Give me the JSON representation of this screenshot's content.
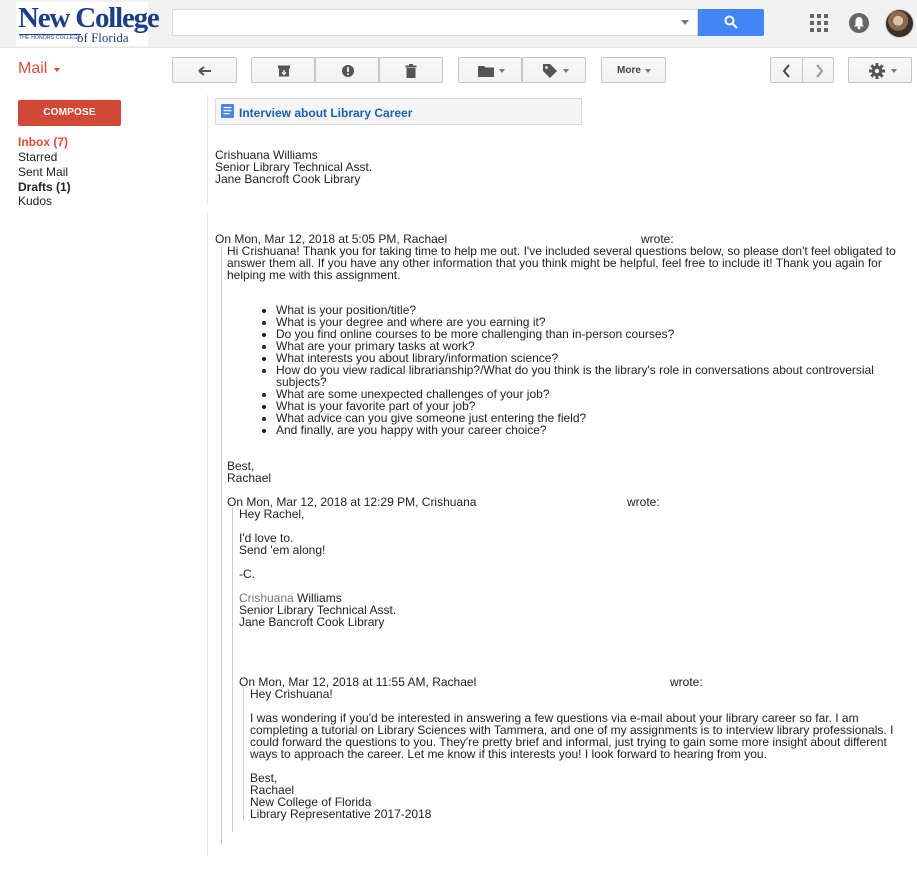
{
  "header": {
    "logo": {
      "name": "New College",
      "tagline": "THE HONORS COLLEGE",
      "sub": "of Florida"
    },
    "search": {
      "value": "",
      "placeholder": ""
    }
  },
  "toolbar": {
    "app_label": "Mail",
    "more_label": "More"
  },
  "sidebar": {
    "compose_label": "COMPOSE",
    "items": [
      {
        "label": "Inbox (7)"
      },
      {
        "label": "Starred"
      },
      {
        "label": "Sent Mail"
      },
      {
        "label": "Drafts (1)"
      },
      {
        "label": "Kudos"
      }
    ]
  },
  "thread": {
    "subject": "Interview about Library Career",
    "reply": {
      "name": "Crishuana Williams",
      "title": "Senior Library Technical Asst.",
      "org": "Jane Bancroft Cook Library"
    },
    "quote1": {
      "header_a": "On Mon, Mar 12, 2018 at 5:05 PM, Rachael",
      "header_b": "wrote:",
      "intro": "Hi Crishuana! Thank you for taking time to help me out. I've included several questions below, so please don't feel obligated to answer them all. If you have any other information that you think might be helpful, feel free to include it! Thank you again for helping me with this assignment.",
      "questions": [
        "What is your position/title?",
        "What is your degree and where are you earning it?",
        "Do you find online courses to be more challenging than in-person courses?",
        "What are your primary tasks at work?",
        "What interests you about library/information science?",
        "How do you view radical librarianship?/What do you think is the library's role in conversations about controversial subjects?",
        "What are some unexpected challenges of your job?",
        "What is your favorite part of your job?",
        "What advice can you give someone just entering the field?",
        "And finally, are you happy with your career choice?"
      ],
      "closing": "Best,",
      "signature": "Rachael"
    },
    "quote2": {
      "header_a": "On Mon, Mar 12, 2018 at 12:29 PM, Crishuana",
      "header_b": "wrote:",
      "greeting": "Hey Rachel,",
      "line1": "I'd love to.",
      "line2": "Send 'em along!",
      "initial": "-C.",
      "sig_first": "Crishuana",
      "sig_last": "Williams",
      "sig_title": "Senior Library Technical Asst.",
      "sig_org": "Jane Bancroft Cook Library"
    },
    "quote3": {
      "header_a": "On Mon, Mar 12, 2018 at 11:55 AM, Rachael",
      "header_b": "wrote:",
      "greeting": "Hey Crishuana!",
      "body": "I was wondering if you'd be interested in answering a few questions via e-mail about your library career so far. I am completing a tutorial on Library Sciences with Tammera, and one of my assignments is to interview library professionals. I could forward the questions to you. They're pretty brief and informal, just trying to gain some more insight about different ways to approach the career. Let me know if this interests you! I look forward to hearing from you.",
      "closing": "Best,",
      "sig_name": "Rachael",
      "sig_org": "New College of Florida",
      "sig_role": "Library Representative 2017-2018"
    }
  }
}
